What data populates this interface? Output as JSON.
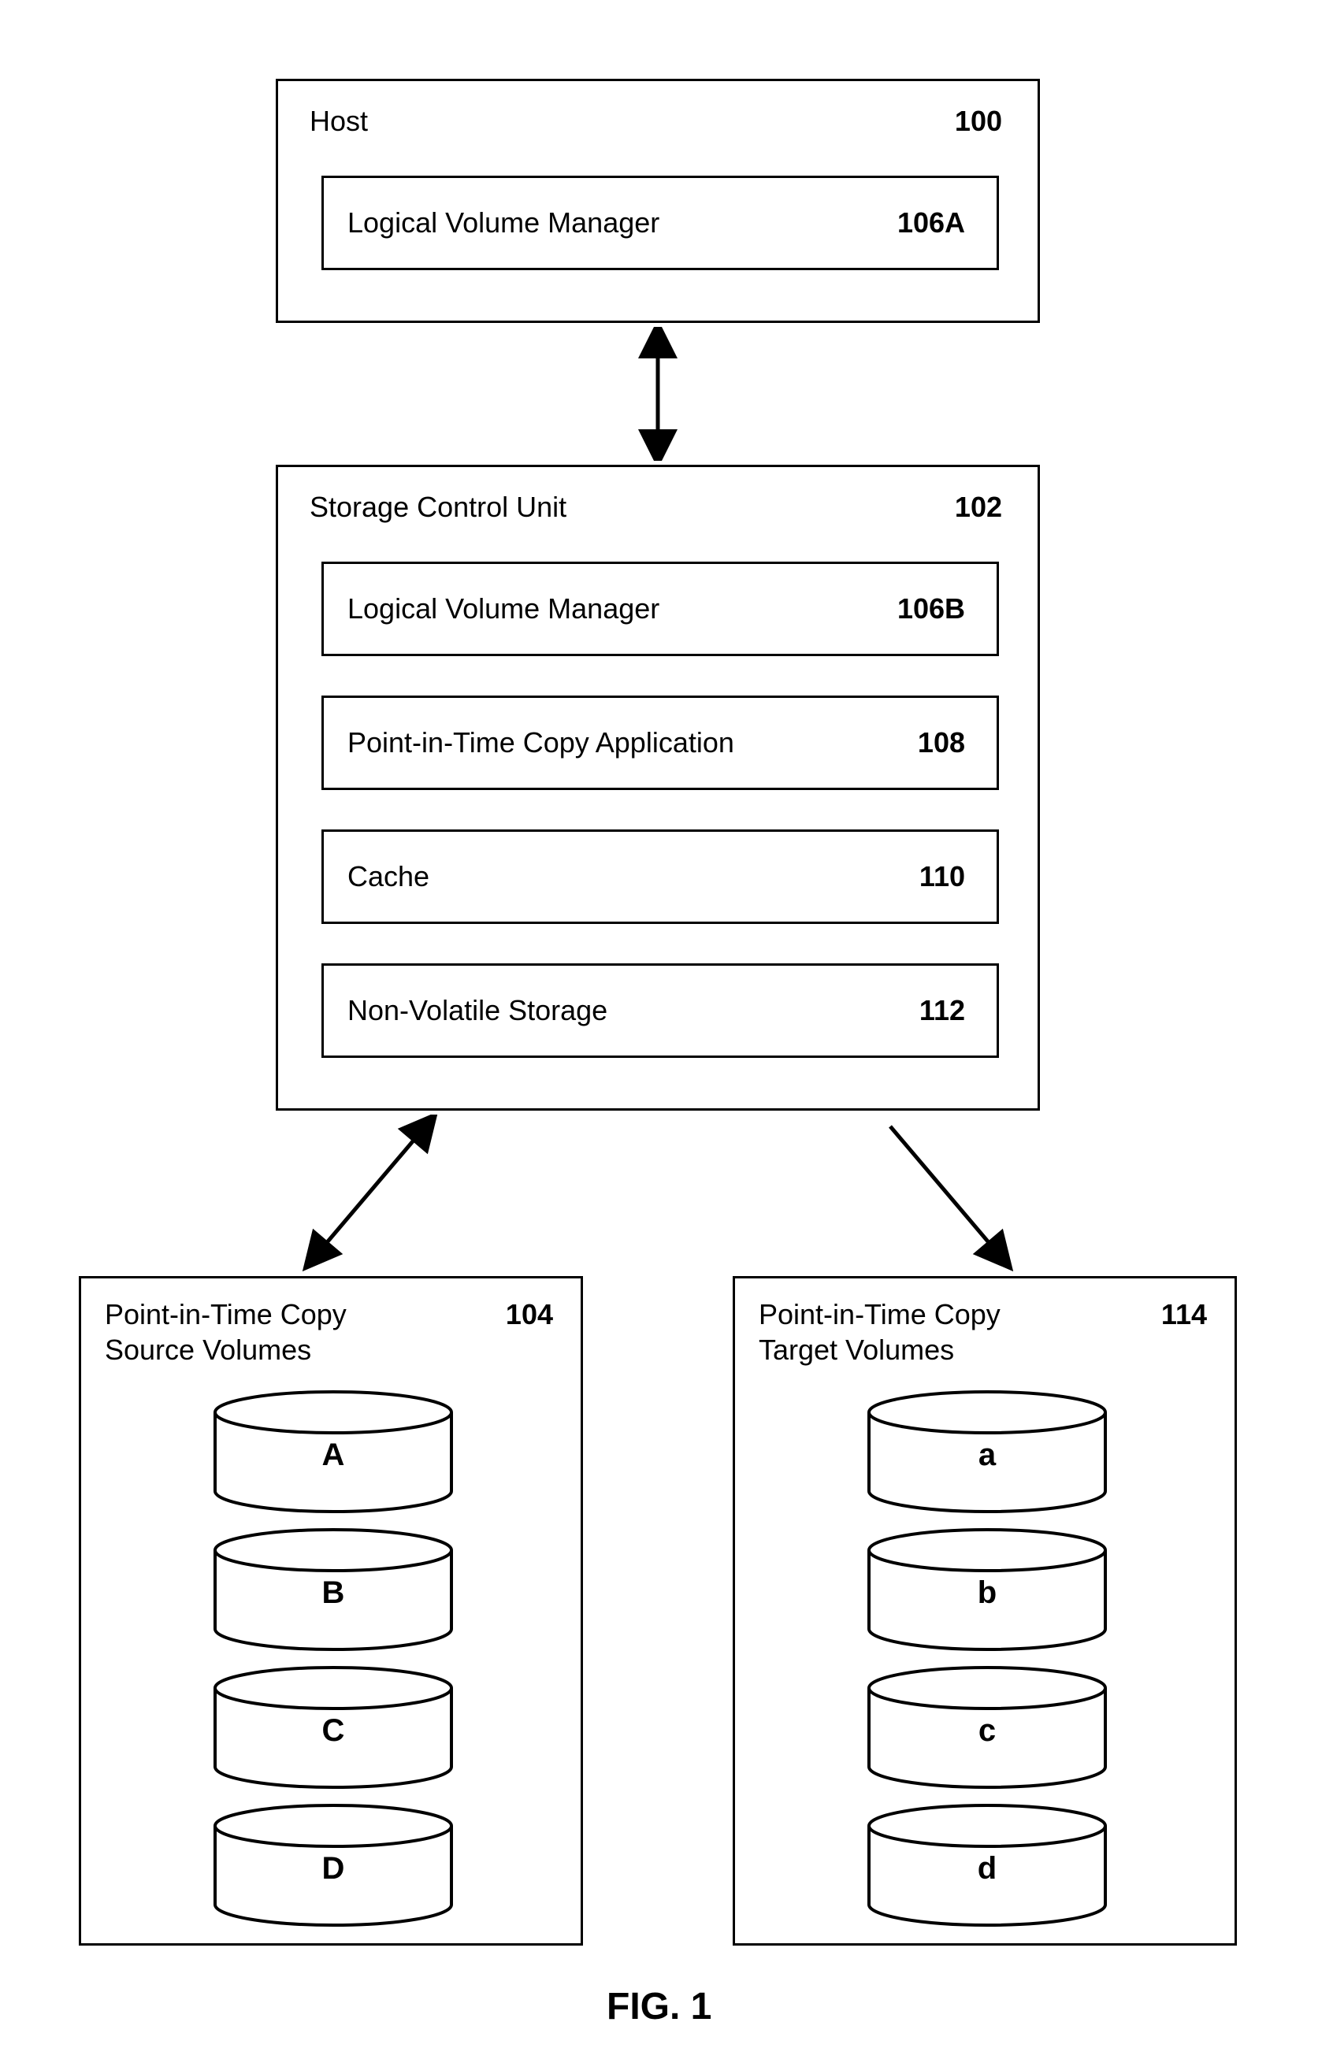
{
  "figure_label": "FIG. 1",
  "host": {
    "title": "Host",
    "ref": "100",
    "lvm": {
      "title": "Logical Volume Manager",
      "ref": "106A"
    }
  },
  "scu": {
    "title": "Storage Control Unit",
    "ref": "102",
    "lvm": {
      "title": "Logical Volume Manager",
      "ref": "106B"
    },
    "pitc": {
      "title": "Point-in-Time Copy Application",
      "ref": "108"
    },
    "cache": {
      "title": "Cache",
      "ref": "110"
    },
    "nvs": {
      "title": "Non-Volatile Storage",
      "ref": "112"
    }
  },
  "source": {
    "title_l1": "Point-in-Time Copy",
    "title_l2": "Source Volumes",
    "ref": "104",
    "vols": {
      "a": "A",
      "b": "B",
      "c": "C",
      "d": "D"
    }
  },
  "target": {
    "title_l1": "Point-in-Time Copy",
    "title_l2": "Target Volumes",
    "ref": "114",
    "vols": {
      "a": "a",
      "b": "b",
      "c": "c",
      "d": "d"
    }
  }
}
